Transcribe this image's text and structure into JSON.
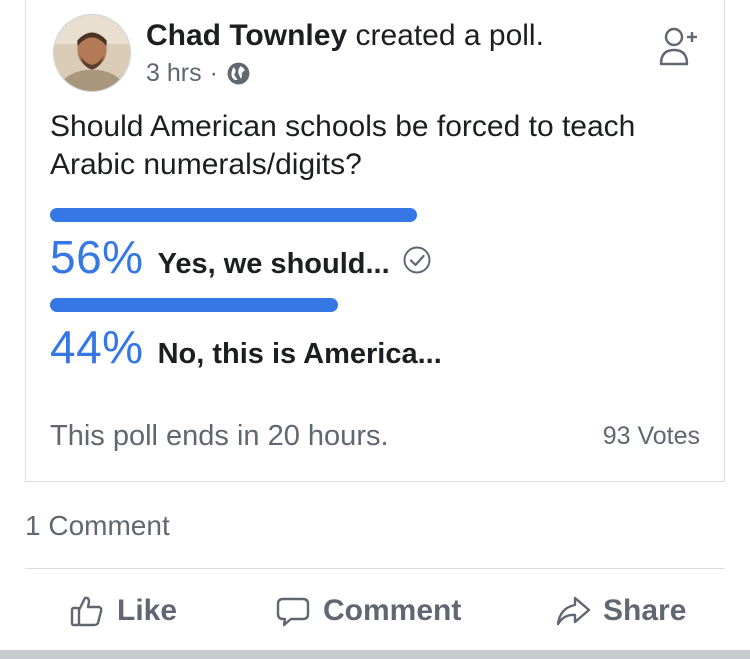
{
  "post": {
    "author_name": "Chad Townley",
    "action_text": " created a poll.",
    "time": "3 hrs",
    "separator": "·",
    "privacy_icon": "globe-icon",
    "follow_icon": "add-friend-icon"
  },
  "poll": {
    "question": "Should American schools be forced to teach Arabic numerals/digits?",
    "options": [
      {
        "percent": "56%",
        "label": "Yes, we should...",
        "fraction": 0.56,
        "voted": true
      },
      {
        "percent": "44%",
        "label": "No, this is America...",
        "fraction": 0.44,
        "voted": false
      }
    ],
    "ends_text": "This poll ends in 20 hours.",
    "votes_text": "93 Votes",
    "bar_color": "#3578e5"
  },
  "comments": {
    "count_text": "1 Comment"
  },
  "actions": {
    "like": "Like",
    "comment": "Comment",
    "share": "Share"
  }
}
